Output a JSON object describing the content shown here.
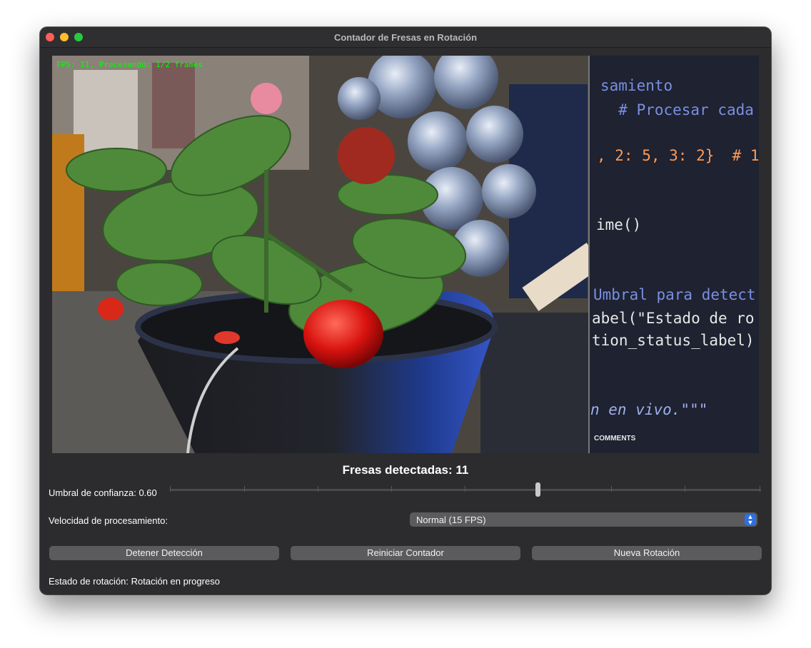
{
  "window": {
    "title": "Contador de Fresas en Rotación"
  },
  "video": {
    "overlay_text": "FPS: 11, Procesando: 1/2 frames",
    "code_lines": [
      "samiento",
      "  # Procesar cada",
      ", 2: 5, 3: 2}  # 1",
      "ime()",
      "Umbral para detect",
      "abel(\"Estado de ro",
      "tion_status_label)",
      "n en vivo.\"\"\""
    ],
    "comments_label": "COMMENTS"
  },
  "counter": {
    "text": "Fresas detectadas: 11"
  },
  "confidence": {
    "label": "Umbral de confianza: 0.60",
    "value": 0.6,
    "min": 0,
    "max": 1
  },
  "speed": {
    "label": "Velocidad de procesamiento:",
    "selected": "Normal (15 FPS)"
  },
  "buttons": {
    "stop": "Detener Detección",
    "reset": "Reiniciar Contador",
    "new_rotation": "Nueva Rotación"
  },
  "status": {
    "text": "Estado de rotación: Rotación en progreso"
  },
  "colors": {
    "window_bg": "#2c2c2e",
    "button_bg": "#5b5b5e",
    "overlay_text": "#00ff00",
    "select_accent": "#2f6fe4"
  }
}
